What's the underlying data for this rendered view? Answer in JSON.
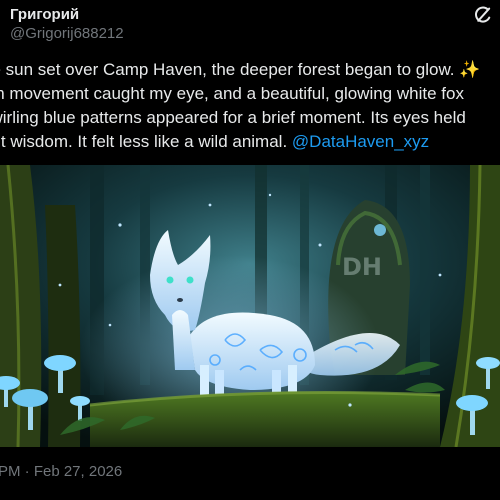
{
  "post": {
    "display_name": "Григорий",
    "handle": "@Grigorij688212",
    "text_lines": [
      "he sun set over Camp Haven, the deeper forest began to glow.",
      "len movement caught my eye, and a beautiful, glowing white fox",
      "swirling blue patterns appeared for a brief moment. Its eyes held",
      "ent wisdom. It felt less like a wild animal."
    ],
    "sparkle": "✨",
    "mention": "@DataHaven_xyz",
    "timestamp": "PM · Feb 27, 2026"
  },
  "media": {
    "watermark": "DH",
    "colors": {
      "background": "#0a1a1f",
      "fox_glow": "#bfe6ff",
      "fox_eye": "#3ee0c9",
      "moss": "#3d5a1e",
      "mushroom": "#7fd6ff"
    }
  },
  "icons": {
    "grok": "grok-icon"
  }
}
